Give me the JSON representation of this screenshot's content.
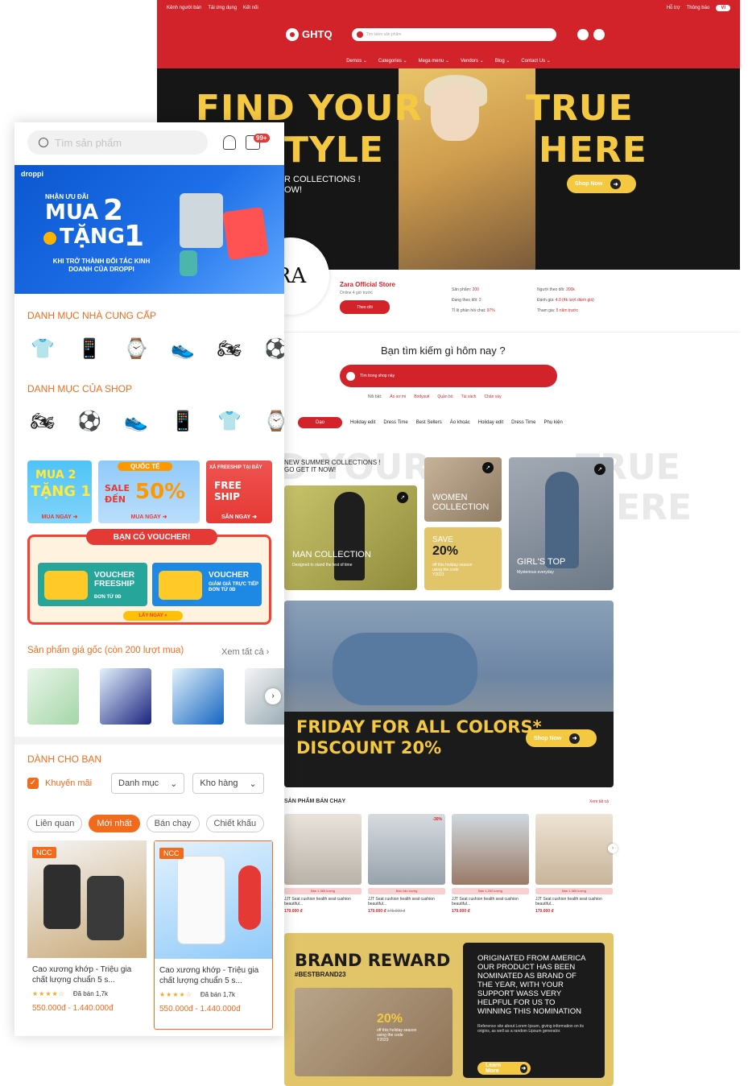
{
  "desktop": {
    "topbar": {
      "left": [
        "Kênh người bán",
        "Tải ứng dụng",
        "Kết nối"
      ],
      "right": [
        "Hỗ trợ",
        "Thông báo"
      ],
      "lang": "VI"
    },
    "header": {
      "logo": "GHTQ",
      "search_placeholder": "Tìm kiếm sản phẩm"
    },
    "nav": [
      "Demos ⌄",
      "Categories ⌄",
      "Mega menu ⌄",
      "Vendors ⌄",
      "Blog ⌄",
      "Contact Us ⌄"
    ],
    "hero": {
      "line1a": "FIND YOUR",
      "line1b": "TRUE",
      "line2a": "TYLE",
      "line2b": "HERE",
      "sub": "R COLLECTIONS !\nOW!",
      "button": "Shop Now"
    },
    "store": {
      "logo_text": "RA",
      "name": "Zara Official Store",
      "online": "Online 4 giờ trước",
      "follow": "Theo dõi",
      "stats": {
        "products_label": "Sản phẩm:",
        "products": "200",
        "following_label": "Đang theo dõi:",
        "following": "2",
        "chat_label": "Tỉ lệ phản hồi chat:",
        "chat": "97%",
        "followers_label": "Người theo dõi:",
        "followers": "200k",
        "rating_label": "Đánh giá:",
        "rating": "4.0 (4k lượt đánh giá)",
        "joined_label": "Tham gia:",
        "joined": "5 năm trước"
      }
    },
    "search": {
      "title": "Bạn tìm kiếm gì hôm nay ?",
      "placeholder": "Tìm trong shop này",
      "trend_label": "Nổi bật:",
      "trend": [
        "Áo sơ mi",
        "Bodysuit",
        "Quần bò",
        "Túi xách",
        "Chân váy"
      ]
    },
    "tabs": [
      "Dạo",
      "Holiday edit",
      "Dress Time",
      "Best Sellers",
      "Áo khoác",
      "Holiday edit",
      "Dress Time",
      "Phụ kiện"
    ],
    "ghost": {
      "a": "D YOUR",
      "b": "TRUE",
      "c": "ERE"
    },
    "collections": {
      "header": "NEW SUMMER COLLECTIONS !\nGO GET IT NOW!",
      "man": {
        "title": "MAN COLLECTION",
        "sub": "Designed to stand the test of time"
      },
      "women": {
        "title": "WOMEN\nCOLLECTION"
      },
      "save": {
        "title": "SAVE",
        "pct": "20%",
        "sub": "off this holiday season\nusing the code\nY2023"
      },
      "girl": {
        "title": "GIRL'S TOP",
        "sub": "Mysterious everyday"
      }
    },
    "promo": {
      "line1": "FRIDAY FOR ALL COLORS*",
      "line2": "DISCOUNT 20%",
      "button": "Shop Now"
    },
    "best": {
      "title": "SẢN PHẨM BÁN CHẠY",
      "see_all": "Xem tất cả",
      "items": [
        {
          "sold": "Bán 1,360 lượng",
          "name": "JJT Seat cushion health seat cushion beautiful...",
          "price": "170.000 đ",
          "old": ""
        },
        {
          "sold": "Bán 1ăn lượng",
          "name": "JJT Seat cushion health seat cushion beautiful...",
          "price": "170.000 đ",
          "old": "175.000 đ",
          "discount": "-30%"
        },
        {
          "sold": "Bán 1,202 lượng",
          "name": "JJT Seat cushion health seat cushion beautiful...",
          "price": "170.000 đ",
          "old": ""
        },
        {
          "sold": "Bán 1,360 lượng",
          "name": "JJT Seat cushion health seat cushion beautiful...",
          "price": "170.000 đ",
          "old": ""
        }
      ]
    },
    "reward": {
      "title": "BRAND REWARD",
      "hashtag": "#BESTBRAND23",
      "pct": "20%",
      "pct_sub": "off this holiday season\nusing the code\nY2023",
      "body": "Originated from America our product has been nominated as brand of the year, with your support wass very helpful for us to winning this nomination",
      "note": "Reference site about Lorem Ipsum, giving information on its origins, as well as a random Lipsum generator.",
      "button": "Learn More"
    }
  },
  "mobile": {
    "search_placeholder": "Tìm sản phẩm",
    "cart_badge": "99+",
    "banner": {
      "brand": "droppi",
      "line1": "NHẬN ƯU ĐÃI",
      "mua": "MUA",
      "two": "2",
      "tang": "TẶNG",
      "one": "1",
      "caption": "KHI TRỞ THÀNH ĐỐI TÁC KINH DOANH CỦA DROPPI"
    },
    "supplier_title": "DANH MỤC NHÀ CUNG CẤP",
    "shop_title": "DANH MỤC CỦA SHOP",
    "supplier_icons": [
      "tshirt-icon",
      "phone-icon",
      "watch-icon",
      "sneaker-icon",
      "motorbike-icon",
      "ball-icon"
    ],
    "shop_icons": [
      "motorbike-icon",
      "ball-icon",
      "sneaker-icon",
      "phone-icon",
      "tshirt-icon",
      "watch-icon"
    ],
    "mini": [
      {
        "t1": "MUA 2",
        "t2": "TẶNG 1",
        "go": "MUA NGAY ➜"
      },
      {
        "top": "QUỐC TẾ",
        "t1": "SALE",
        "t2": "ĐẾN",
        "pct": "50%",
        "go": "MUA NGAY ➜"
      },
      {
        "top": "XẢ FREESHIP TẠI ĐÂY",
        "t1": "FREE",
        "t2": "SHIP",
        "go": "SĂN NGAY ➜"
      }
    ],
    "voucher": {
      "head": "BẠN CÓ VOUCHER!",
      "v1": {
        "title": "VOUCHER\nFREESHIP",
        "sub": "ĐƠN TỪ 0Đ"
      },
      "v2": {
        "title": "VOUCHER",
        "sub": "GIẢM GIÁ TRỰC TIẾP\nĐƠN TỪ 0Đ"
      },
      "button": "LẤY NGAY »"
    },
    "orig_title": "Sản phẩm giá gốc (còn 200 lượt mua)",
    "see_all": "Xem tất cả ›",
    "for_you": "DÀNH CHO BẠN",
    "promo_check": "Khuyến mãi",
    "dd1": "Danh mục",
    "dd2": "Kho hàng",
    "chips": [
      "Liên quan",
      "Mới nhất",
      "Bán chạy",
      "Chiết khấu"
    ],
    "products": [
      {
        "badge": "NCC",
        "name": "Cao xương khớp - Triệu gia chất lượng chuẩn 5 s...",
        "stars": "★★★★☆",
        "sold": "Đã bán 1,7k",
        "price": "550.000đ - 1.440.000đ"
      },
      {
        "badge": "NCC",
        "name": "Cao xương khớp - Triệu gia chất lượng chuẩn 5 s...",
        "stars": "★★★★☆",
        "sold": "Đã bán 1,7k",
        "price": "550.000đ - 1.440.000đ"
      }
    ]
  },
  "colors": {
    "brand_red": "#d2232a",
    "accent_yellow": "#f5c842",
    "mobile_orange": "#f26b1d"
  }
}
